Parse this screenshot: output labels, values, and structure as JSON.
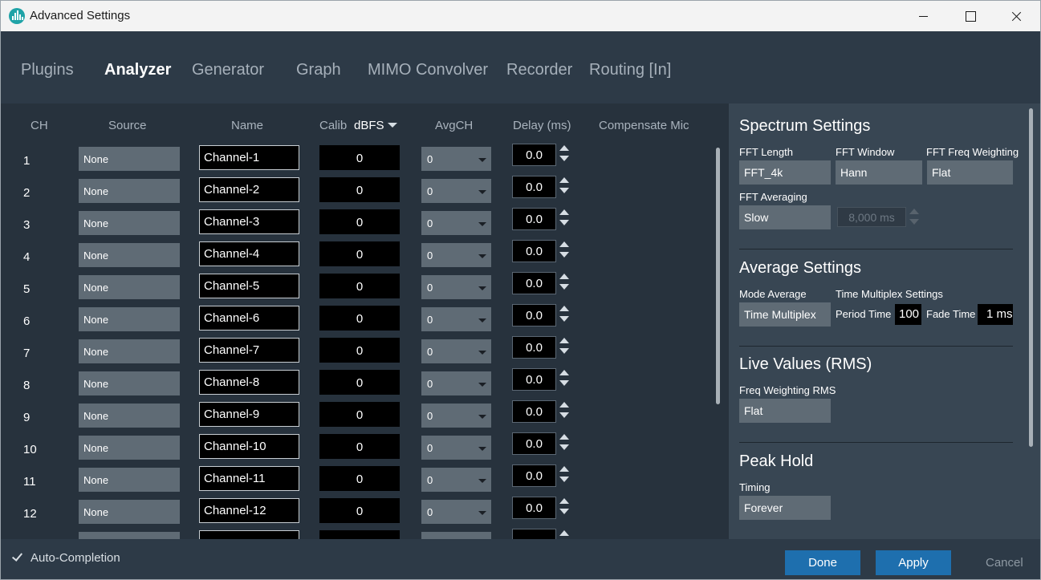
{
  "window": {
    "title": "Advanced Settings"
  },
  "tabs": [
    {
      "label": "Plugins",
      "active": false
    },
    {
      "label": "Analyzer",
      "active": true
    },
    {
      "label": "Generator",
      "active": false
    },
    {
      "label": "Graph",
      "active": false
    },
    {
      "label": "MIMO Convolver",
      "active": false
    },
    {
      "label": "Recorder",
      "active": false
    },
    {
      "label": "Routing [In]",
      "active": false
    }
  ],
  "channel_table": {
    "headers": {
      "ch": "CH",
      "source": "Source",
      "name": "Name",
      "calib": "Calib",
      "calib_unit": "dBFS",
      "avgch": "AvgCH",
      "delay": "Delay (ms)",
      "compensate": "Compensate Mic"
    },
    "rows": [
      {
        "ch": "1",
        "source": "None",
        "name": "Channel-1",
        "calib": "0",
        "avgch": "0",
        "delay": "0.0"
      },
      {
        "ch": "2",
        "source": "None",
        "name": "Channel-2",
        "calib": "0",
        "avgch": "0",
        "delay": "0.0"
      },
      {
        "ch": "3",
        "source": "None",
        "name": "Channel-3",
        "calib": "0",
        "avgch": "0",
        "delay": "0.0"
      },
      {
        "ch": "4",
        "source": "None",
        "name": "Channel-4",
        "calib": "0",
        "avgch": "0",
        "delay": "0.0"
      },
      {
        "ch": "5",
        "source": "None",
        "name": "Channel-5",
        "calib": "0",
        "avgch": "0",
        "delay": "0.0"
      },
      {
        "ch": "6",
        "source": "None",
        "name": "Channel-6",
        "calib": "0",
        "avgch": "0",
        "delay": "0.0"
      },
      {
        "ch": "7",
        "source": "None",
        "name": "Channel-7",
        "calib": "0",
        "avgch": "0",
        "delay": "0.0"
      },
      {
        "ch": "8",
        "source": "None",
        "name": "Channel-8",
        "calib": "0",
        "avgch": "0",
        "delay": "0.0"
      },
      {
        "ch": "9",
        "source": "None",
        "name": "Channel-9",
        "calib": "0",
        "avgch": "0",
        "delay": "0.0"
      },
      {
        "ch": "10",
        "source": "None",
        "name": "Channel-10",
        "calib": "0",
        "avgch": "0",
        "delay": "0.0"
      },
      {
        "ch": "11",
        "source": "None",
        "name": "Channel-11",
        "calib": "0",
        "avgch": "0",
        "delay": "0.0"
      },
      {
        "ch": "12",
        "source": "None",
        "name": "Channel-12",
        "calib": "0",
        "avgch": "0",
        "delay": "0.0"
      }
    ]
  },
  "spectrum": {
    "title": "Spectrum Settings",
    "fft_length_label": "FFT Length",
    "fft_length": "FFT_4k",
    "fft_window_label": "FFT Window",
    "fft_window": "Hann",
    "fft_weighting_label": "FFT Freq Weighting",
    "fft_weighting": "Flat",
    "fft_averaging_label": "FFT Averaging",
    "fft_averaging": "Slow",
    "averaging_time": "8,000 ms"
  },
  "average": {
    "title": "Average Settings",
    "mode_label": "Mode Average",
    "mode": "Time Multiplex",
    "tm_label": "Time Multiplex Settings",
    "period_label": "Period Time",
    "period": "100 ms",
    "fade_label": "Fade Time",
    "fade": "1 ms"
  },
  "live": {
    "title": "Live Values (RMS)",
    "weighting_label": "Freq Weighting RMS",
    "weighting": "Flat"
  },
  "peak": {
    "title": "Peak Hold",
    "timing_label": "Timing",
    "timing": "Forever"
  },
  "footer": {
    "auto_completion": "Auto-Completion",
    "done": "Done",
    "apply": "Apply",
    "cancel": "Cancel"
  },
  "colors": {
    "accent": "#4db3e6",
    "button": "#1e6fae",
    "panel": "#384653",
    "background": "#2d3a47"
  }
}
